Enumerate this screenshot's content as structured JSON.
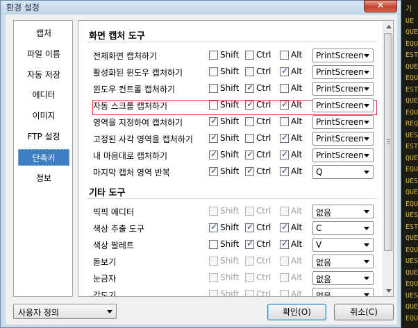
{
  "window": {
    "title": "환경 설정",
    "close_glyph": "✕"
  },
  "sidebar": {
    "items": [
      {
        "label": "캡처",
        "selected": false
      },
      {
        "label": "파일 이름",
        "selected": false
      },
      {
        "label": "자동 저장",
        "selected": false
      },
      {
        "label": "에디터",
        "selected": false
      },
      {
        "label": "이미지",
        "selected": false
      },
      {
        "label": "FTP 설정",
        "selected": false
      },
      {
        "label": "단축키",
        "selected": true
      },
      {
        "label": "정보",
        "selected": false
      }
    ]
  },
  "sections": {
    "capture_tools": "화면 캡처 도구",
    "other_tools": "기타 도구"
  },
  "modifiers": {
    "shift": "Shift",
    "ctrl": "Ctrl",
    "alt": "Alt"
  },
  "rows": [
    {
      "label": "전체화면 캡처하기",
      "shift": false,
      "ctrl": false,
      "alt": false,
      "key": "PrintScreen",
      "disabled": false
    },
    {
      "label": "활성화된 윈도우 캡처하기",
      "shift": false,
      "ctrl": false,
      "alt": true,
      "key": "PrintScreen",
      "disabled": false
    },
    {
      "label": "윈도우 컨트롤 캡처하기",
      "shift": false,
      "ctrl": true,
      "alt": false,
      "key": "PrintScreen",
      "disabled": false
    },
    {
      "label": "자동 스크롤 캡처하기",
      "shift": false,
      "ctrl": true,
      "alt": true,
      "key": "PrintScreen",
      "disabled": false,
      "highlighted": true
    },
    {
      "label": "영역을 지정하여 캡처하기",
      "shift": true,
      "ctrl": false,
      "alt": false,
      "key": "PrintScreen",
      "disabled": false
    },
    {
      "label": "고정된 사각 영역을 캡처하기",
      "shift": true,
      "ctrl": false,
      "alt": true,
      "key": "PrintScreen",
      "disabled": false
    },
    {
      "label": "내 마음대로 캡처하기",
      "shift": true,
      "ctrl": true,
      "alt": true,
      "key": "PrintScreen",
      "disabled": false
    },
    {
      "label": "마지막 캡처 영역 반복",
      "shift": true,
      "ctrl": true,
      "alt": true,
      "key": "Q",
      "disabled": false
    },
    {
      "label": "픽픽 에디터",
      "shift": false,
      "ctrl": false,
      "alt": false,
      "key": "없음",
      "disabled": true
    },
    {
      "label": "색상 추출 도구",
      "shift": true,
      "ctrl": true,
      "alt": true,
      "key": "C",
      "disabled": false
    },
    {
      "label": "색상 팔레트",
      "shift": false,
      "ctrl": true,
      "alt": true,
      "key": "V",
      "disabled": false
    },
    {
      "label": "돋보기",
      "shift": false,
      "ctrl": false,
      "alt": false,
      "key": "없음",
      "disabled": true
    },
    {
      "label": "눈금자",
      "shift": false,
      "ctrl": false,
      "alt": false,
      "key": "없음",
      "disabled": true
    },
    {
      "label": "각도기",
      "shift": false,
      "ctrl": false,
      "alt": false,
      "key": "없음",
      "disabled": true
    }
  ],
  "footer": {
    "preset_value": "사용자 정의",
    "ok_label": "확인(O)",
    "cancel_label": "취소(C)"
  },
  "background_code": [
    "기",
    "UE",
    "QUE",
    "EQU",
    "EST",
    "QUE",
    "EQU",
    "EST",
    "QUE",
    "EQU",
    "REQ",
    "UES",
    "EST",
    "QUE",
    "EQU",
    "UES",
    "QUE",
    "EQU",
    "UES",
    "EST",
    "QUE",
    "EQU",
    "UES",
    "QUE",
    "EQU",
    "UES",
    "QUE",
    "EQU"
  ]
}
